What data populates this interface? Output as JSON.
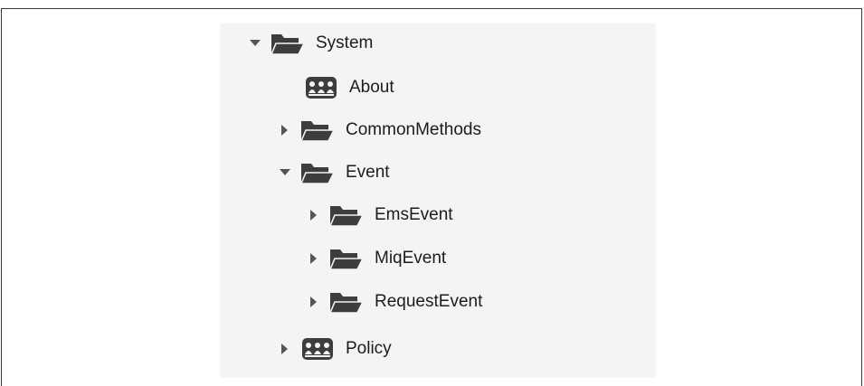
{
  "tree": {
    "nodes": [
      {
        "label": "System",
        "icon": "folder-open-icon",
        "toggle": "expanded"
      },
      {
        "label": "About",
        "icon": "class-icon",
        "toggle": "none"
      },
      {
        "label": "CommonMethods",
        "icon": "folder-open-icon",
        "toggle": "collapsed"
      },
      {
        "label": "Event",
        "icon": "folder-open-icon",
        "toggle": "expanded"
      },
      {
        "label": "EmsEvent",
        "icon": "folder-open-icon",
        "toggle": "collapsed"
      },
      {
        "label": "MiqEvent",
        "icon": "folder-open-icon",
        "toggle": "collapsed"
      },
      {
        "label": "RequestEvent",
        "icon": "folder-open-icon",
        "toggle": "collapsed"
      },
      {
        "label": "Policy",
        "icon": "class-icon",
        "toggle": "collapsed"
      }
    ]
  },
  "colors": {
    "panel": "#f4f4f4",
    "icon": "#3d3d3d",
    "text": "#1c1c1c"
  }
}
